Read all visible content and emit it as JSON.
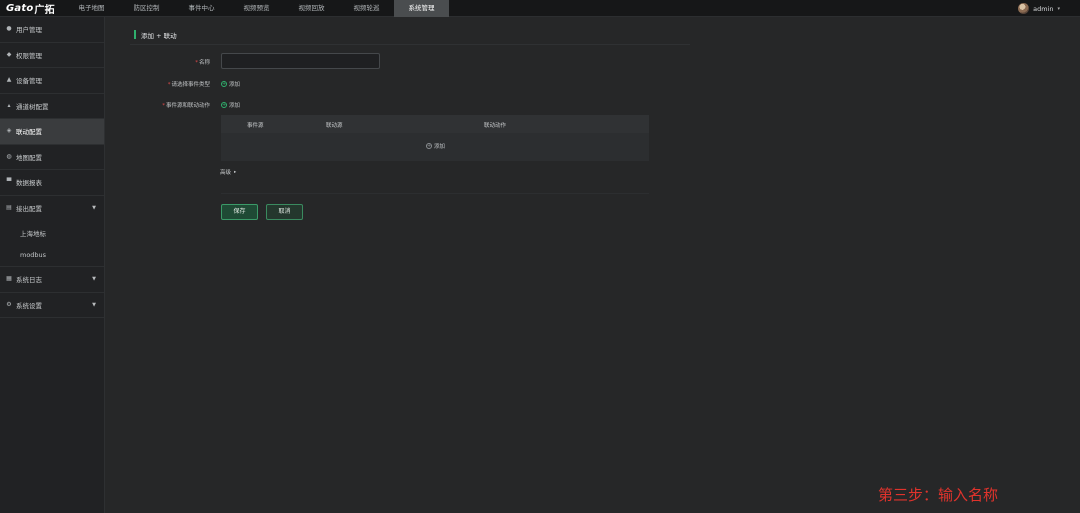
{
  "brand": {
    "logo_text": "Gato",
    "logo_cn": "广拓"
  },
  "nav": {
    "tabs": [
      {
        "label": "电子地图"
      },
      {
        "label": "防区控制"
      },
      {
        "label": "事件中心"
      },
      {
        "label": "视频预览"
      },
      {
        "label": "视频回放"
      },
      {
        "label": "视频轮巡"
      },
      {
        "label": "系统管理",
        "active": true
      }
    ]
  },
  "user": {
    "name": "admin",
    "caret": "▾"
  },
  "sidebar": {
    "items": [
      {
        "label": "用户管理",
        "icon": "user-icon",
        "glyph": "●"
      },
      {
        "label": "权限管理",
        "icon": "shield-icon",
        "glyph": "◆"
      },
      {
        "label": "设备管理",
        "icon": "device-icon",
        "glyph": "▲"
      },
      {
        "label": "通道树配置",
        "icon": "tree-icon",
        "glyph": "▴"
      },
      {
        "label": "联动配置",
        "icon": "link-icon",
        "glyph": "◈",
        "active": true
      },
      {
        "label": "地图配置",
        "icon": "map-icon",
        "glyph": "◍"
      },
      {
        "label": "数据报表",
        "icon": "report-icon",
        "glyph": "▀"
      },
      {
        "label": "接出配置",
        "icon": "output-icon",
        "glyph": "▤",
        "caret": "▼"
      },
      {
        "label": "系统日志",
        "icon": "log-icon",
        "glyph": "▦",
        "caret": "▼"
      },
      {
        "label": "系统设置",
        "icon": "settings-icon",
        "glyph": "⚙",
        "caret": "▼"
      }
    ],
    "subitems": [
      {
        "label": "上海地标"
      },
      {
        "label": "modbus"
      }
    ]
  },
  "page": {
    "title": "添加 + 联动"
  },
  "form": {
    "required_mark": "*",
    "name_label": "名称",
    "name_value": "",
    "event_type_label": "请选择事件类型",
    "event_action_label": "事件源和联动动作",
    "add_label": "添加",
    "table": {
      "headers": [
        "事件源",
        "联动源",
        "联动动作"
      ],
      "add_label": "添加"
    },
    "advanced_label": "高级",
    "advanced_caret": "▸",
    "save_label": "保存",
    "cancel_label": "取消"
  },
  "caption": {
    "text": "第三步：输入名称",
    "color": "#e0332c"
  },
  "colors": {
    "accent": "#2fb06d",
    "required": "#e14a4a",
    "active_tab": "#4a4d4f"
  }
}
